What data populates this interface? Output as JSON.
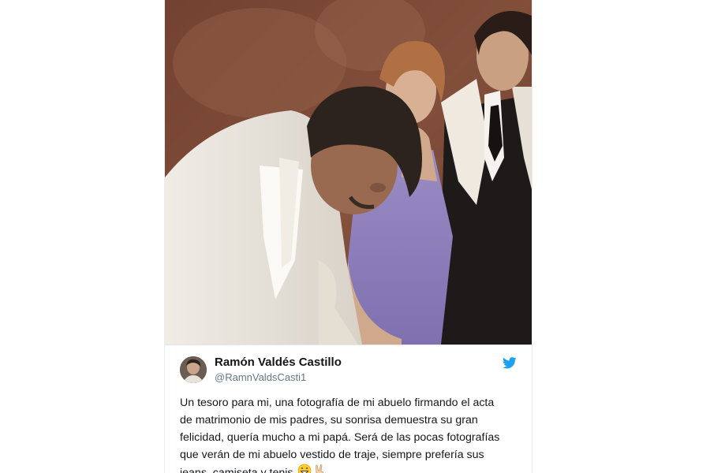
{
  "tweet": {
    "author_name": "Ramón Valdés Castillo",
    "author_handle": "@RamnValdsCasti1",
    "text_lines": [
      "Un tesoro para mi, una fotografía de mi abuelo firmando el acta",
      "de matrimonio de mis padres, su sonrisa demuestra su gran",
      "felicidad, quería mucho a mi papá. Será de las pocas fotografías",
      "que verán de mi abuelo vestido de traje, siempre prefería sus",
      "jeans, camiseta y tenis."
    ],
    "emojis": [
      "grinning-face-emoji",
      "victory-hand-emoji"
    ]
  },
  "icons": {
    "platform": "twitter-bird-icon",
    "twitter_blue": "#1da1f2"
  },
  "colors": {
    "name": "#14171a",
    "handle": "#657786",
    "text": "#14171a"
  }
}
